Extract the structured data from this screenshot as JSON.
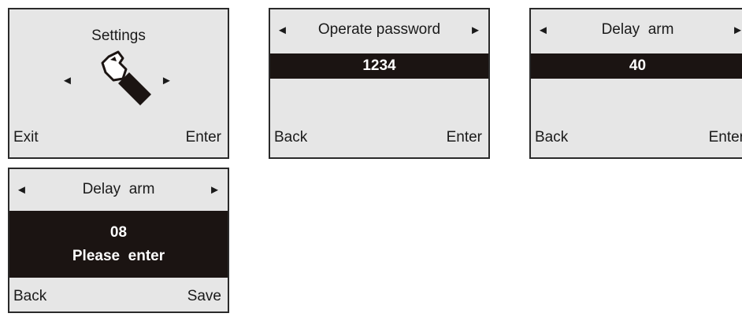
{
  "screens": [
    {
      "title": "Settings",
      "icon": "wrench-hand-icon",
      "left_arrow": "◄",
      "right_arrow": "►",
      "softkey_left": "Exit",
      "softkey_right": "Enter"
    },
    {
      "title": "Operate password",
      "left_arrow": "◄",
      "right_arrow": "►",
      "value": "1234",
      "softkey_left": "Back",
      "softkey_right": "Enter"
    },
    {
      "title": "Delay  arm",
      "left_arrow": "◄",
      "right_arrow": "►",
      "value": "40",
      "softkey_left": "Back",
      "softkey_right": "Enter"
    },
    {
      "title": "Delay  arm",
      "left_arrow": "◄",
      "right_arrow": "►",
      "value": "08",
      "prompt": "Please  enter",
      "softkey_left": "Back",
      "softkey_right": "Save"
    }
  ],
  "colors": {
    "screen_bg": "#e6e6e6",
    "highlight_bar": "#1b1412",
    "border": "#2a2a2a"
  }
}
